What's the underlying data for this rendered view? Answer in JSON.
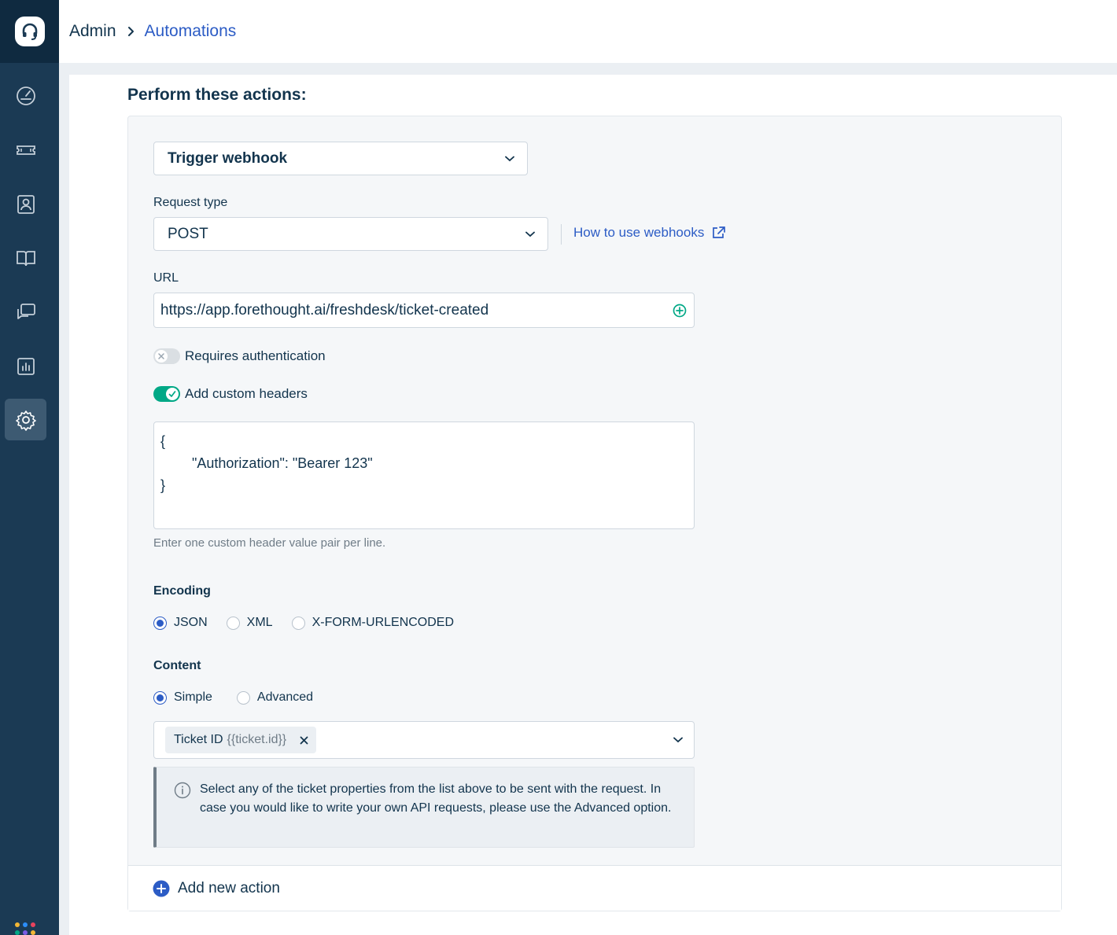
{
  "header": {
    "breadcrumb_root": "Admin",
    "breadcrumb_current": "Automations"
  },
  "sidebar": {
    "items": [
      {
        "icon": "dashboard-icon",
        "active": false
      },
      {
        "icon": "tickets-icon",
        "active": false
      },
      {
        "icon": "contacts-icon",
        "active": false
      },
      {
        "icon": "solutions-book-icon",
        "active": false
      },
      {
        "icon": "forums-chat-icon",
        "active": false
      },
      {
        "icon": "reports-icon",
        "active": false
      },
      {
        "icon": "admin-gear-icon",
        "active": true
      }
    ]
  },
  "section": {
    "title": "Perform these actions:"
  },
  "action": {
    "type_value": "Trigger webhook",
    "request_type_label": "Request type",
    "request_type_value": "POST",
    "help_link": "How to use webhooks",
    "url_label": "URL",
    "url_value": "https://app.forethought.ai/freshdesk/ticket-created",
    "auth_toggle_label": "Requires authentication",
    "headers_toggle_label": "Add custom headers",
    "headers_value": "{\n        \"Authorization\": \"Bearer 123\"\n}",
    "headers_hint": "Enter one custom header value pair per line.",
    "encoding_label": "Encoding",
    "encoding_options": [
      "JSON",
      "XML",
      "X-FORM-URLENCODED"
    ],
    "encoding_selected": "JSON",
    "content_label": "Content",
    "content_options": [
      "Simple",
      "Advanced"
    ],
    "content_selected": "Simple",
    "chip_label": "Ticket ID",
    "chip_code": "{{ticket.id}}",
    "info_text": "Select any of the ticket properties from the list above to be sent with the request. In case you would like to write your own API requests, please use the Advanced option."
  },
  "footer": {
    "add_action_label": "Add new action"
  },
  "colors": {
    "sidebar": "#1b3a54",
    "link": "#2c5cc5",
    "toggle_on": "#00a886",
    "add_icon_green": "#00a886"
  }
}
